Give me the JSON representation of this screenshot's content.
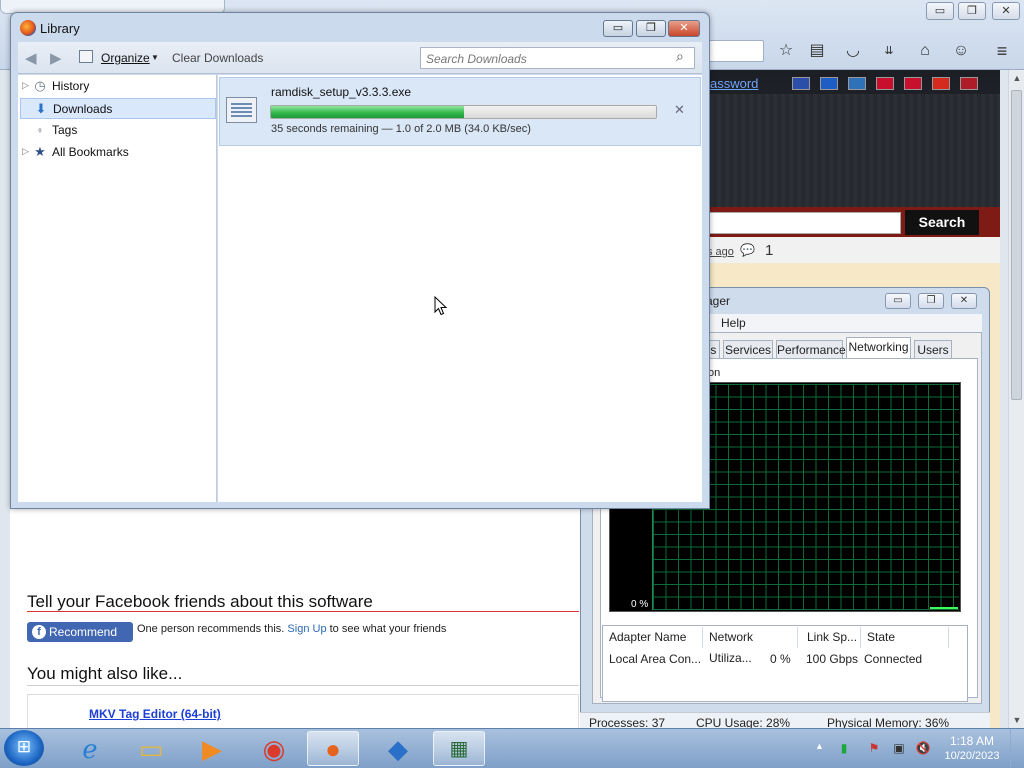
{
  "firefox": {
    "caption_minimize": "▭",
    "caption_restore": "❐",
    "caption_close": "✕",
    "password_link_fragment": "assword",
    "search_button": "Search",
    "meta_ago": "s ago",
    "meta_comment_count": "1",
    "facebook_heading": "Tell your Facebook friends about this software",
    "recommend_button": "Recommend",
    "recommend_text": "One person recommends this.",
    "signup_link": "Sign Up",
    "recommend_tail": "to see what your friends",
    "also_like_heading": "You might also like...",
    "related_link": "MKV Tag Editor (64-bit)",
    "flags": [
      "#2b4ea8",
      "#1d5dc4",
      "#2f71b9",
      "#c8102e",
      "#c8102e",
      "#d52b1e",
      "#ae1c28"
    ]
  },
  "library": {
    "title": "Library",
    "toolbar": {
      "organize": "Organize",
      "clear_downloads": "Clear Downloads",
      "search_placeholder": "Search Downloads"
    },
    "sidebar": [
      {
        "label": "History",
        "icon": "clock-icon",
        "twisty": true,
        "selected": false
      },
      {
        "label": "Downloads",
        "icon": "download-arrow-icon",
        "twisty": false,
        "selected": true
      },
      {
        "label": "Tags",
        "icon": "tag-icon",
        "twisty": false,
        "selected": false
      },
      {
        "label": "All Bookmarks",
        "icon": "bookmark-star-icon",
        "twisty": true,
        "selected": false
      }
    ],
    "download": {
      "filename": "ramdisk_setup_v3.3.3.exe",
      "progress_fraction": 0.5,
      "status": "35 seconds remaining — 1.0 of 2.0 MB (34.0 KB/sec)"
    }
  },
  "task_manager": {
    "title_fragment": "ager",
    "menu_help": "Help",
    "tabs": [
      {
        "label": "es",
        "active": false
      },
      {
        "label": "Services",
        "active": false
      },
      {
        "label": "Performance",
        "active": false
      },
      {
        "label": "Networking",
        "active": true
      },
      {
        "label": "Users",
        "active": false
      }
    ],
    "graph_label_fragment": "on",
    "graph_zero_label": "0 %",
    "columns": [
      "Adapter Name",
      "Network Utiliza...",
      "Link Sp...",
      "State"
    ],
    "rows": [
      {
        "adapter": "Local Area Con...",
        "utilization": "0 %",
        "speed": "100 Gbps",
        "state": "Connected"
      }
    ],
    "status": {
      "processes": "Processes: 37",
      "cpu": "CPU Usage: 28%",
      "memory": "Physical Memory: 36%"
    }
  },
  "taskbar": {
    "clock_time": "1:18 AM",
    "clock_date": "10/20/2023"
  }
}
